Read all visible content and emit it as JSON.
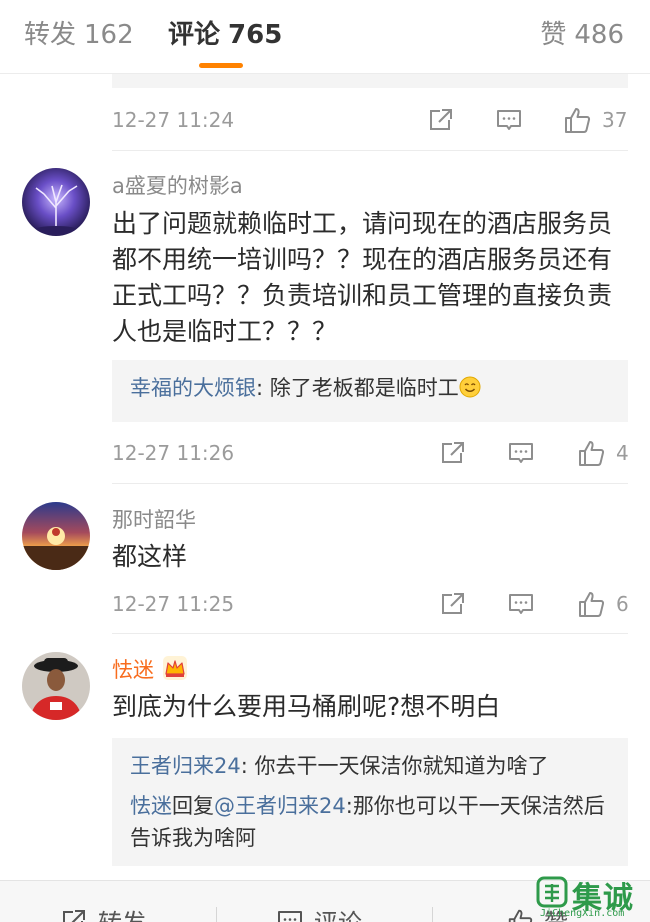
{
  "tabs": {
    "repost": {
      "label": "转发",
      "count": "162"
    },
    "comment": {
      "label": "评论",
      "count": "765"
    },
    "like": {
      "label": "赞",
      "count": "486"
    }
  },
  "accent_color": "#ff8200",
  "comments": [
    {
      "time": "12-27 11:24",
      "likes": "37"
    },
    {
      "user": "a盛夏的树影a",
      "text": "出了问题就赖临时工，请问现在的酒店服务员都不用统一培训吗？？现在的酒店服务员还有正式工吗？？负责培训和员工管理的直接负责人也是临时工？？？",
      "replies": [
        {
          "name": "幸福的大烦银",
          "sep": ": ",
          "text": "除了老板都是临时工",
          "emoji": "smile-emoji"
        }
      ],
      "time": "12-27 11:26",
      "likes": "4"
    },
    {
      "user": "那时韶华",
      "text": "都这样",
      "time": "12-27 11:25",
      "likes": "6"
    },
    {
      "user": "怯迷",
      "badge": "crown-icon",
      "text": "到底为什么要用马桶刷呢?想不明白",
      "replies": [
        {
          "name": "王者归来24",
          "sep": ": ",
          "text": "你去干一天保洁你就知道为啥了"
        },
        {
          "name": "怯迷",
          "mid": "回复",
          "mention": "@王者归来24",
          "sep": ":",
          "text": "那你也可以干一天保洁然后告诉我为啥阿"
        }
      ]
    }
  ],
  "bottom_bar": {
    "repost": "转发",
    "comment": "评论",
    "like": "赞"
  },
  "watermark": {
    "text": "集诚信",
    "small": "JiChengXin.com"
  }
}
